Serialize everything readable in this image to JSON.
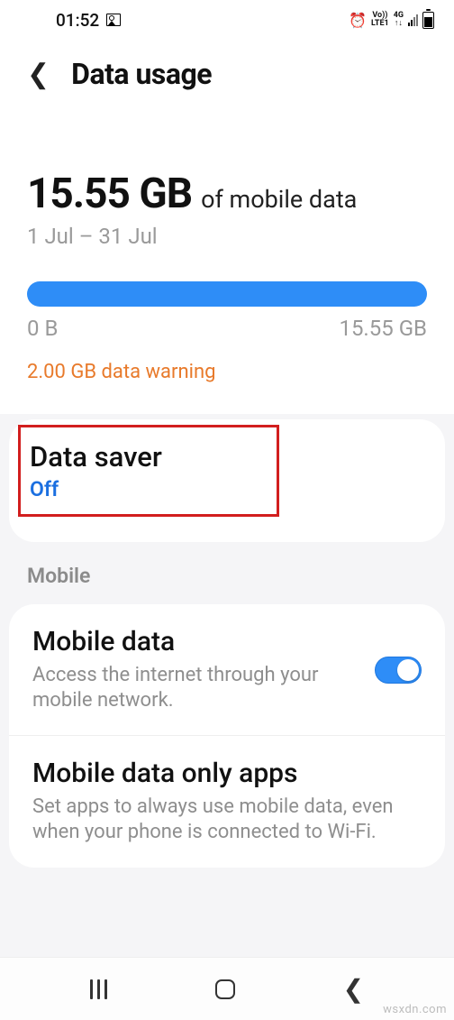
{
  "status": {
    "time": "01:52",
    "icons": {
      "picture": "picture-icon",
      "alarm": "⏰",
      "net1_top": "Vo))",
      "net1_bot": "LTE1",
      "net2_top": "4G",
      "net2_bot": "↑↓"
    }
  },
  "header": {
    "title": "Data usage"
  },
  "usage": {
    "value": "15.55 GB",
    "suffix": "of mobile data",
    "range": "1 Jul – 31 Jul",
    "min_label": "0 B",
    "max_label": "15.55 GB",
    "warning": "2.00 GB data warning"
  },
  "data_saver": {
    "title": "Data saver",
    "status": "Off"
  },
  "sections": {
    "mobile_header": "Mobile"
  },
  "mobile_data": {
    "title": "Mobile data",
    "desc": "Access the internet through your mobile network.",
    "toggle_on": true
  },
  "mobile_only": {
    "title": "Mobile data only apps",
    "desc": "Set apps to always use mobile data, even when your phone is connected to Wi-Fi."
  },
  "watermark": "wsxdn.com"
}
